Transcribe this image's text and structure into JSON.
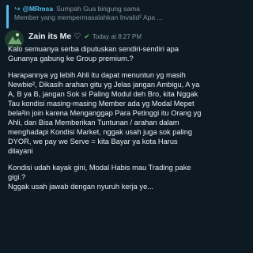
{
  "reply": {
    "sender": "@MRmsa",
    "line1": "Sumpah Gua bingung sama",
    "line2": "Member yang mempermasalahkan Invalid² Apa ..."
  },
  "message": {
    "sender": "Zain its Me",
    "time": "Today at 8:27 PM",
    "paragraphs": [
      "Kalo semuanya serba diputuskan sendiri-sendiri apa Gunanya gabung ke Group premium.?",
      "Harapannya yg lebih Ahli itu dapat menuntun yg masih Newbie², Dikasih arahan gitu yg Jelas jangan Ambigu, A ya A, B ya B, jangan Sok si Paling Modul deh Bro, kita Nggak Tau kondisi masing-masing Member ada yg Modal Mepet bela²in join karena Menganggap Para Petinggi itu Orang yg Ahli, dan Bisa Memberikan Tuntunan / arahan dalam menghadapi Kondisi Market, nggak usah juga sok paling DYOR, we pay we Serve = kita Bayar ya kota Harus dilayani",
      "Kondisi udah kayak gini, Modal Habis mau Trading pake gigi.?",
      "Nggak usah jawab dengan nyuruh kerja ye..."
    ]
  },
  "colors": {
    "background": "#0d1a24",
    "mention": "#53bdeb",
    "check": "#4caf50"
  },
  "icons": {
    "reply": "reply-arrow-icon",
    "heart": "heart-icon",
    "verified": "check-icon"
  }
}
